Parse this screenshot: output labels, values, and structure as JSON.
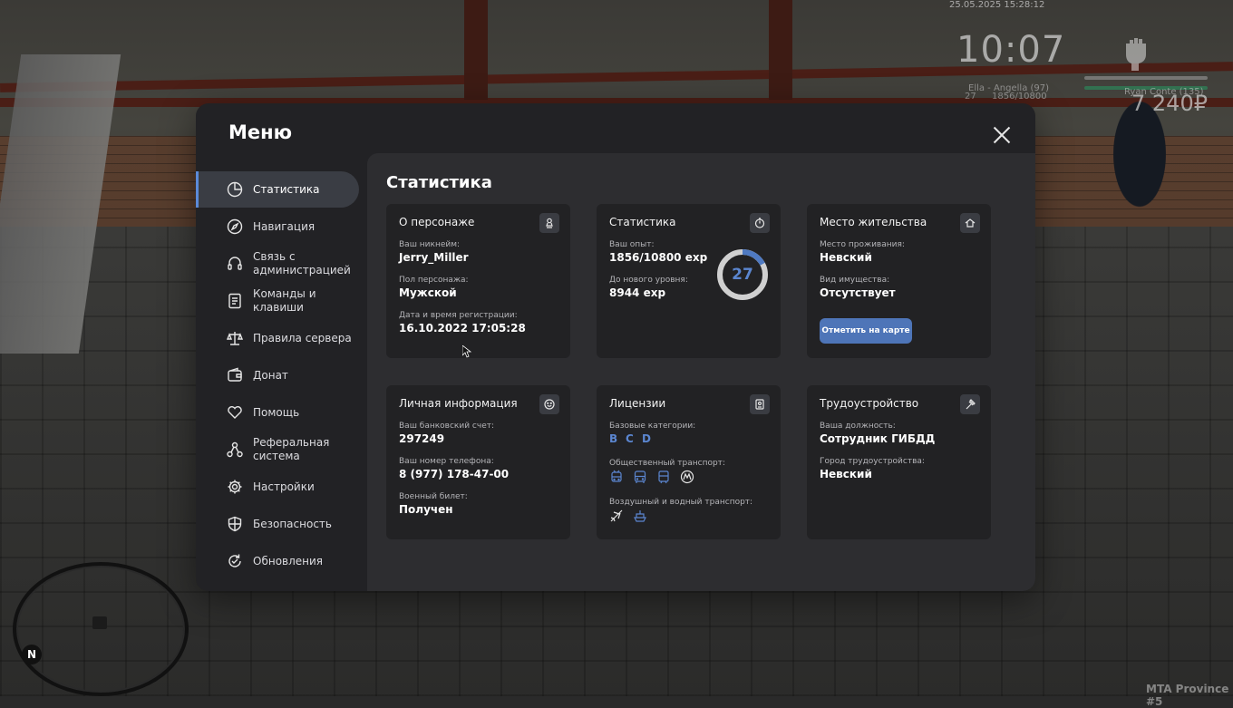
{
  "hud": {
    "date": "25.05.2025 15:28:12",
    "clock": "10:07",
    "player_label": "Ella - Angella (97)",
    "level": "27",
    "exp": "1856/10800",
    "target_label": "Ryan Conte (135)",
    "money": "7 240₽",
    "north": "N",
    "server": "MTA Province #5"
  },
  "menu": {
    "title": "Меню",
    "sidebar": [
      {
        "label": "Статистика",
        "icon": "pie-chart-icon",
        "active": true
      },
      {
        "label": "Навигация",
        "icon": "compass-icon"
      },
      {
        "label": "Связь с администрацией",
        "icon": "headset-icon"
      },
      {
        "label": "Команды и клавиши",
        "icon": "document-icon"
      },
      {
        "label": "Правила сервера",
        "icon": "scales-icon"
      },
      {
        "label": "Донат",
        "icon": "wallet-icon"
      },
      {
        "label": "Помощь",
        "icon": "heart-hands-icon"
      },
      {
        "label": "Реферальная система",
        "icon": "network-icon"
      },
      {
        "label": "Настройки",
        "icon": "gear-icon"
      },
      {
        "label": "Безопасность",
        "icon": "shield-icon"
      },
      {
        "label": "Обновления",
        "icon": "refresh-icon"
      }
    ]
  },
  "stats": {
    "title": "Статистика",
    "character": {
      "title": "О персонаже",
      "nickname_label": "Ваш никнейм:",
      "nickname": "Jerry_Miller",
      "gender_label": "Пол персонажа:",
      "gender": "Мужской",
      "reg_label": "Дата и время регистрации:",
      "reg_date": "16.10.2022 17:05:28"
    },
    "statistics": {
      "title": "Статистика",
      "exp_label": "Ваш опыт:",
      "exp": "1856/10800 exp",
      "next_label": "До нового уровня:",
      "next": "8944 exp",
      "level": "27",
      "progress": 0.172
    },
    "residence": {
      "title": "Место жительства",
      "place_label": "Место проживания:",
      "place": "Невский",
      "property_label": "Вид имущества:",
      "property": "Отсутствует",
      "map_button": "Отметить на карте"
    },
    "personal": {
      "title": "Личная информация",
      "bank_label": "Ваш банковский счет:",
      "bank": "297249",
      "phone_label": "Ваш номер телефона:",
      "phone": "8 (977) 178-47-00",
      "military_label": "Военный билет:",
      "military": "Получен"
    },
    "licenses": {
      "title": "Лицензии",
      "base_label": "Базовые категории:",
      "categories": [
        "B",
        "C",
        "D"
      ],
      "public_label": "Общественный транспорт:",
      "public_icons": [
        "trolleybus-icon",
        "bus-icon",
        "tram-icon",
        "metro-icon"
      ],
      "air_water_label": "Воздушный и водный транспорт:",
      "air_water_icons": [
        "plane-icon",
        "boat-icon"
      ]
    },
    "job": {
      "title": "Трудоустройство",
      "position_label": "Ваша должность:",
      "position": "Сотрудник ГИБДД",
      "city_label": "Город трудоустройства:",
      "city": "Невский"
    }
  }
}
